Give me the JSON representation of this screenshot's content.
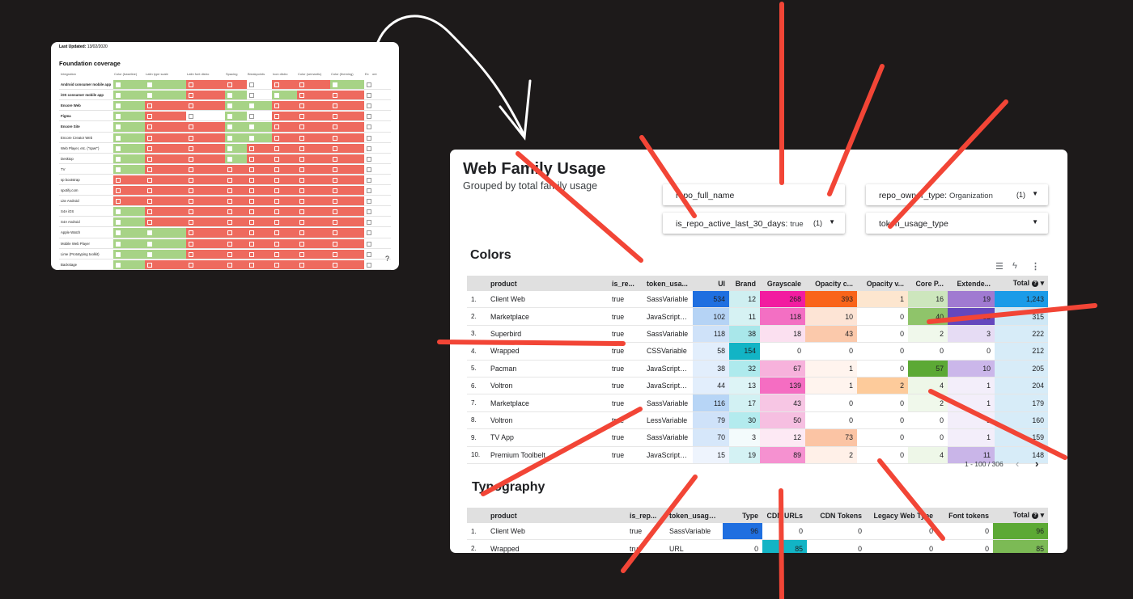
{
  "coverage": {
    "last_updated_label": "Last Updated:",
    "last_updated_value": "13/02/2020",
    "title": "Foundation coverage",
    "columns": [
      "Integration",
      "Color (baseline)",
      "Latin type scale",
      "Latin font distro",
      "Spacing",
      "Breakpoints",
      "Icon distro",
      "Color (semantic)",
      "Color (theming)",
      "Ex",
      "ore"
    ],
    "rows": [
      {
        "name": "Android consumer mobile app",
        "bold": true,
        "cells": "ggrrwrrgw"
      },
      {
        "name": "iOS consumer mobile app",
        "bold": true,
        "cells": "ggrgwgrrw"
      },
      {
        "name": "Encore Web",
        "bold": true,
        "cells": "grrggrrrw"
      },
      {
        "name": "Figma",
        "bold": true,
        "cells": "grwgwrrrw"
      },
      {
        "name": "Encore Site",
        "bold": true,
        "cells": "grrggrrrw"
      },
      {
        "name": "Encore Creator Web",
        "bold": false,
        "cells": "grrggrrrw"
      },
      {
        "name": "Web Player, etc. (\"spwr\")",
        "bold": false,
        "cells": "grrgrrrrw"
      },
      {
        "name": "Desktop",
        "bold": false,
        "cells": "grrgrrrrw"
      },
      {
        "name": "TV",
        "bold": false,
        "cells": "grrrrrrrw"
      },
      {
        "name": "sp bootstrap",
        "bold": false,
        "cells": "rrrrrrrrw"
      },
      {
        "name": "spotify.com",
        "bold": false,
        "cells": "rrrrrrrrw"
      },
      {
        "name": "Lite Android",
        "bold": false,
        "cells": "rrrrrrrrw"
      },
      {
        "name": "S4A iOS",
        "bold": false,
        "cells": "grrrrrrrw"
      },
      {
        "name": "S4A Android",
        "bold": false,
        "cells": "grrrrrrrw"
      },
      {
        "name": "Apple Watch",
        "bold": false,
        "cells": "ggrrrrrrw"
      },
      {
        "name": "Mobile Web Player",
        "bold": false,
        "cells": "ggrrrrrrw"
      },
      {
        "name": "Lime (Prototyping toolkit)",
        "bold": false,
        "cells": "ggrrrrrrw"
      },
      {
        "name": "Backstage",
        "bold": false,
        "cells": "grrrrrrrw"
      }
    ],
    "help_label": "?"
  },
  "dashboard": {
    "title": "Web Family Usage",
    "subtitle": "Grouped by total family usage",
    "filters": [
      {
        "label": "repo_full_name",
        "value": "",
        "count": ""
      },
      {
        "label": "repo_owner_type:",
        "value": "Organization",
        "count": "(1)"
      },
      {
        "label": "is_repo_active_last_30_days:",
        "value": "true",
        "count": "(1)"
      },
      {
        "label": "token_usage_type",
        "value": "",
        "count": ""
      }
    ],
    "colors_section": {
      "title": "Colors",
      "columns": [
        "",
        "product",
        "is_re...",
        "token_usa...",
        "UI",
        "Brand",
        "Grayscale",
        "Opacity c...",
        "Opacity v...",
        "Core P...",
        "Extende...",
        "Total"
      ],
      "rows": [
        [
          "1.",
          "Client Web",
          "true",
          "SassVariable",
          "534",
          "12",
          "268",
          "393",
          "1",
          "16",
          "19",
          "1,243"
        ],
        [
          "2.",
          "Marketplace",
          "true",
          "JavaScriptVa...",
          "102",
          "11",
          "118",
          "10",
          "0",
          "40",
          "33",
          "315"
        ],
        [
          "3.",
          "Superbird",
          "true",
          "SassVariable",
          "118",
          "38",
          "18",
          "43",
          "0",
          "2",
          "3",
          "222"
        ],
        [
          "4.",
          "Wrapped",
          "true",
          "CSSVariable",
          "58",
          "154",
          "0",
          "0",
          "0",
          "0",
          "0",
          "212"
        ],
        [
          "5.",
          "Pacman",
          "true",
          "JavaScriptVa...",
          "38",
          "32",
          "67",
          "1",
          "0",
          "57",
          "10",
          "205"
        ],
        [
          "6.",
          "Voltron",
          "true",
          "JavaScriptVa...",
          "44",
          "13",
          "139",
          "1",
          "2",
          "4",
          "1",
          "204"
        ],
        [
          "7.",
          "Marketplace",
          "true",
          "SassVariable",
          "116",
          "17",
          "43",
          "0",
          "0",
          "2",
          "1",
          "179"
        ],
        [
          "8.",
          "Voltron",
          "true",
          "LessVariable",
          "79",
          "30",
          "50",
          "0",
          "0",
          "0",
          "1",
          "160"
        ],
        [
          "9.",
          "TV App",
          "true",
          "SassVariable",
          "70",
          "3",
          "12",
          "73",
          "0",
          "0",
          "1",
          "159"
        ],
        [
          "10.",
          "Premium Toolbelt",
          "true",
          "JavaScriptVa...",
          "15",
          "19",
          "89",
          "2",
          "0",
          "4",
          "11",
          "148"
        ]
      ],
      "pager": "1 - 100 / 306"
    },
    "typography_section": {
      "title": "Typography",
      "columns": [
        "",
        "product",
        "is_rep...",
        "token_usage...",
        "Type",
        "CDN URLs",
        "CDN Tokens",
        "Legacy Web Type",
        "Font tokens",
        "Total"
      ],
      "rows": [
        [
          "1.",
          "Client Web",
          "true",
          "SassVariable",
          "96",
          "0",
          "0",
          "0",
          "0",
          "96"
        ],
        [
          "2.",
          "Wrapped",
          "true",
          "URL",
          "0",
          "85",
          "0",
          "0",
          "0",
          "85"
        ]
      ]
    }
  },
  "colors": {
    "background": "#1d1a1a",
    "red_mark": "#f24536",
    "cell_green": "#a7d386",
    "cell_red": "#ee6a5e"
  }
}
